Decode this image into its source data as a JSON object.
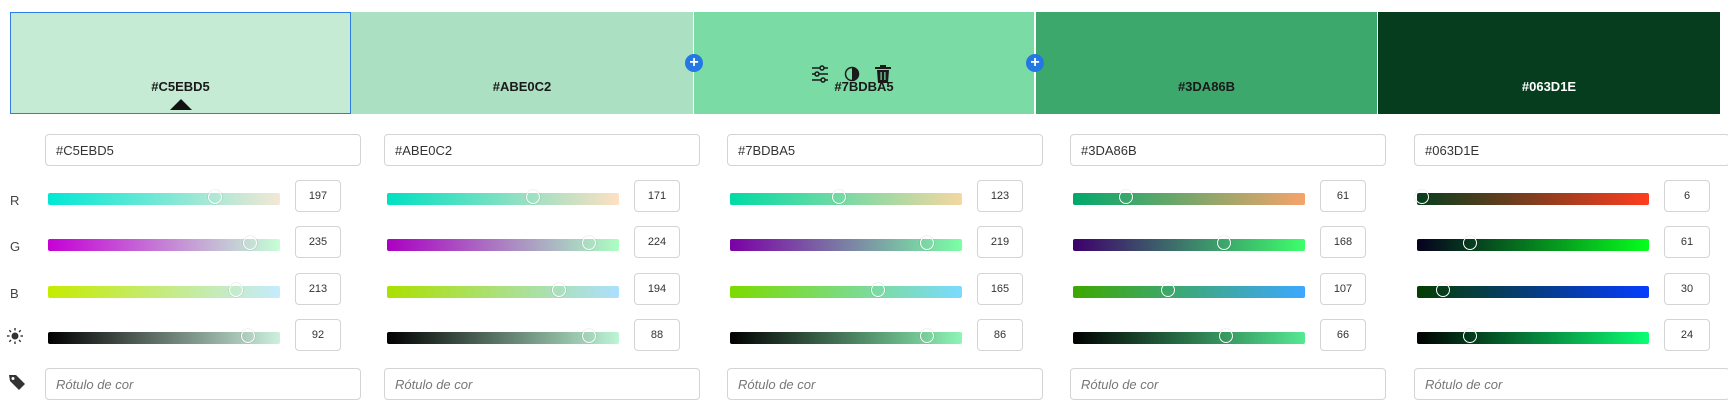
{
  "swatches": [
    {
      "hex": "#C5EBD5",
      "color": "#C5EBD5",
      "text_color": "#1a1a1a",
      "selected": true
    },
    {
      "hex": "#ABE0C2",
      "color": "#ABE0C2",
      "text_color": "#1a1a1a"
    },
    {
      "hex": "#7BDBA5",
      "color": "#7BDBA5",
      "text_color": "#1a1a1a"
    },
    {
      "hex": "#3DA86B",
      "color": "#3DA86B",
      "text_color": "#1a1a1a"
    },
    {
      "hex": "#063D1E",
      "color": "#063D1E",
      "text_color": "#ffffff"
    }
  ],
  "toolbar_icons": [
    "adjust-sliders-icon",
    "contrast-icon",
    "trash-icon"
  ],
  "add_icon": "+",
  "row_labels": {
    "r": "R",
    "g": "G",
    "b": "B",
    "brightness_icon": "brightness-icon",
    "label_icon": "tag-icon"
  },
  "label_placeholder": "Rótulo de cor",
  "columns": [
    {
      "hex": "#C5EBD5",
      "r": {
        "value": "197",
        "grad": [
          "#00e8d5",
          "#f3e8d5"
        ],
        "pos": 0.72
      },
      "g": {
        "value": "235",
        "grad": [
          "#c500d5",
          "#c5ffd5"
        ],
        "pos": 0.87
      },
      "b": {
        "value": "213",
        "grad": [
          "#c5eb00",
          "#c5ebff"
        ],
        "pos": 0.81
      },
      "l": {
        "value": "92",
        "grad": [
          "#000000",
          "#ccf0de"
        ],
        "pos": 0.86
      }
    },
    {
      "hex": "#ABE0C2",
      "r": {
        "value": "171",
        "grad": [
          "#00e0c2",
          "#ffe0c2"
        ],
        "pos": 0.63
      },
      "g": {
        "value": "224",
        "grad": [
          "#ab00c2",
          "#abffc2"
        ],
        "pos": 0.87
      },
      "b": {
        "value": "194",
        "grad": [
          "#abe000",
          "#abe0ff"
        ],
        "pos": 0.74
      },
      "l": {
        "value": "88",
        "grad": [
          "#000000",
          "#bdf5d6"
        ],
        "pos": 0.87
      }
    },
    {
      "hex": "#7BDBA5",
      "r": {
        "value": "123",
        "grad": [
          "#00dba5",
          "#f5d7a1"
        ],
        "pos": 0.47
      },
      "g": {
        "value": "219",
        "grad": [
          "#7b00a5",
          "#7bffa5"
        ],
        "pos": 0.85
      },
      "b": {
        "value": "165",
        "grad": [
          "#7bdb00",
          "#7bdbff"
        ],
        "pos": 0.64
      },
      "l": {
        "value": "86",
        "grad": [
          "#000000",
          "#8ef5b6"
        ],
        "pos": 0.85
      }
    },
    {
      "hex": "#3DA86B",
      "r": {
        "value": "61",
        "grad": [
          "#00a86b",
          "#f5a46a"
        ],
        "pos": 0.23
      },
      "g": {
        "value": "168",
        "grad": [
          "#3d006b",
          "#3dff6b"
        ],
        "pos": 0.65
      },
      "b": {
        "value": "107",
        "grad": [
          "#3da800",
          "#3da8ff"
        ],
        "pos": 0.41
      },
      "l": {
        "value": "66",
        "grad": [
          "#000000",
          "#55e993"
        ],
        "pos": 0.66
      }
    },
    {
      "hex": "#063D1E",
      "r": {
        "value": "6",
        "grad": [
          "#063d1e",
          "#ff3d1e"
        ],
        "pos": 0.02
      },
      "g": {
        "value": "61",
        "grad": [
          "#06001e",
          "#06ff1e"
        ],
        "pos": 0.23
      },
      "b": {
        "value": "30",
        "grad": [
          "#063d00",
          "#063dff"
        ],
        "pos": 0.11
      },
      "l": {
        "value": "24",
        "grad": [
          "#000000",
          "#0bff73"
        ],
        "pos": 0.23
      }
    }
  ]
}
